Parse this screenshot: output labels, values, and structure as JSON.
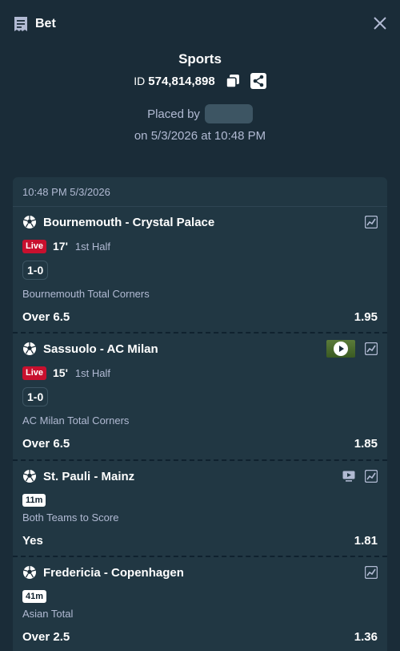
{
  "header": {
    "title": "Bet",
    "icons": [
      "receipt-icon",
      "close-icon"
    ]
  },
  "summary": {
    "sport": "Sports",
    "id_label": "ID",
    "id_value": "574,814,898",
    "placed_by_label": "Placed by",
    "placed_on": "on 5/3/2026 at 10:48 PM"
  },
  "card": {
    "timestamp": "10:48 PM 5/3/2026",
    "legs": [
      {
        "match": "Bournemouth - Crystal Palace",
        "live": "Live",
        "minute": "17'",
        "period": "1st Half",
        "score": "1-0",
        "market": "Bournemouth Total Corners",
        "selection": "Over 6.5",
        "odds": "1.95"
      },
      {
        "match": "Sassuolo - AC Milan",
        "live": "Live",
        "minute": "15'",
        "period": "1st Half",
        "score": "1-0",
        "market": "AC Milan Total Corners",
        "selection": "Over 6.5",
        "odds": "1.85"
      },
      {
        "match": "St. Pauli - Mainz",
        "time_badge": "11m",
        "market": "Both Teams to Score",
        "selection": "Yes",
        "odds": "1.81"
      },
      {
        "match": "Fredericia - Copenhagen",
        "time_badge": "41m",
        "market": "Asian Total",
        "selection": "Over 2.5",
        "odds": "1.36"
      }
    ]
  },
  "colors": {
    "background": "#1a2c38",
    "card": "#213743",
    "muted": "#b1bad3",
    "live": "#c8102e"
  }
}
